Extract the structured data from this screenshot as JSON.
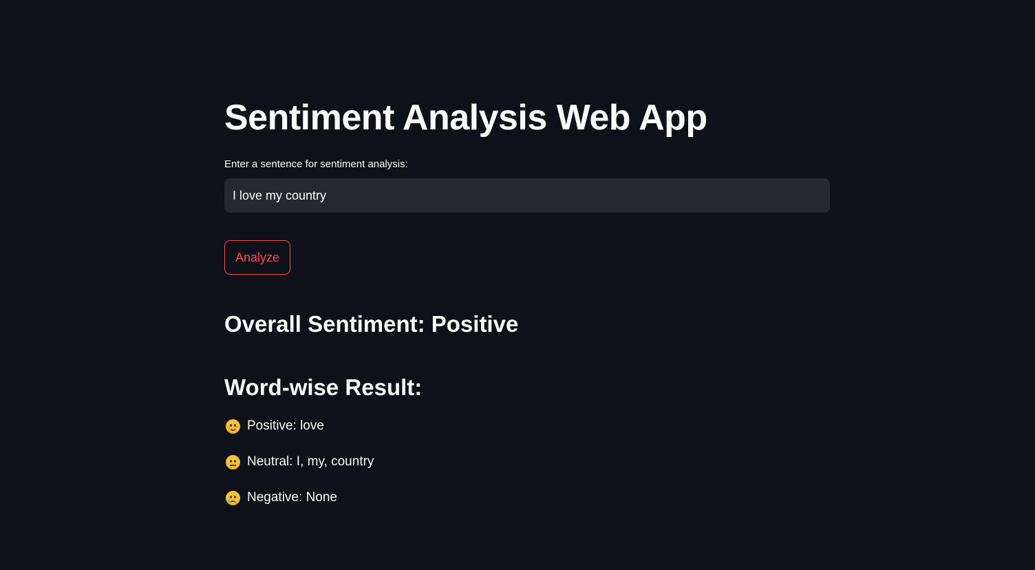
{
  "app": {
    "title": "Sentiment Analysis Web App"
  },
  "input": {
    "label": "Enter a sentence for sentiment analysis:",
    "value": "I love my country"
  },
  "actions": {
    "analyze_label": "Analyze"
  },
  "results": {
    "overall": "Overall Sentiment: Positive",
    "wordwise_heading": "Word-wise Result:",
    "lines": [
      {
        "icon": "smiling-face-icon",
        "text": "Positive: love"
      },
      {
        "icon": "neutral-face-icon",
        "text": "Neutral: I, my, country"
      },
      {
        "icon": "sad-face-icon",
        "text": "Negative: None"
      }
    ]
  },
  "colors": {
    "background": "#0e1117",
    "input_background": "#262730",
    "accent": "#ff4b4b",
    "text": "#fafafa"
  }
}
